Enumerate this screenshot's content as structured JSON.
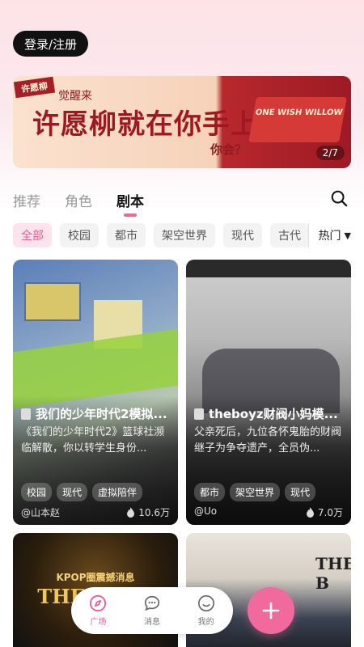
{
  "header": {
    "login_label": "登录/注册"
  },
  "banner": {
    "ribbon": "许愿柳",
    "subtitle": "觉醒来",
    "title": "许愿柳就在你手上",
    "question": "你会？",
    "tag": "ONE WISH WILLOW",
    "pager": "2/7"
  },
  "tabs": [
    {
      "label": "推荐"
    },
    {
      "label": "角色"
    },
    {
      "label": "剧本"
    }
  ],
  "filters": [
    {
      "label": "全部"
    },
    {
      "label": "校园"
    },
    {
      "label": "都市"
    },
    {
      "label": "架空世界"
    },
    {
      "label": "现代"
    },
    {
      "label": "古代"
    }
  ],
  "sort": {
    "label": "热门"
  },
  "cards": [
    {
      "title": "我们的少年时代2模拟...",
      "desc": "《我们的少年时代2》篮球社濒临解散，你以转学生身份...",
      "tags": [
        "校园",
        "现代",
        "虚拟陪伴"
      ],
      "author": "@山本赵",
      "heat": "10.6万"
    },
    {
      "title": "theboyz财阀小妈模...",
      "desc": "父亲死后，九位各怀鬼胎的财阀继子为争夺遗产，全员伪...",
      "tags": [
        "都市",
        "架空世界",
        "现代"
      ],
      "author": "@Uo",
      "heat": "7.0万"
    },
    {
      "overlay": "KPOP圈震撼消息",
      "overlay2": "THE BOYZ"
    },
    {
      "overlay": "THE B"
    }
  ],
  "bottom_nav": [
    {
      "label": "广场"
    },
    {
      "label": "消息"
    },
    {
      "label": "我的"
    }
  ],
  "colors": {
    "accent": "#f06a9e",
    "dark": "#111111"
  }
}
